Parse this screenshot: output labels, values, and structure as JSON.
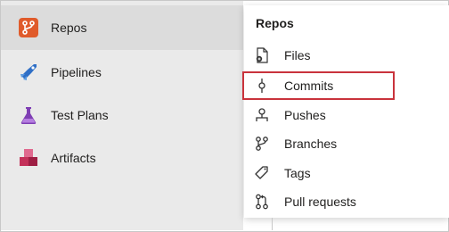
{
  "sidebar": {
    "items": [
      {
        "label": "Repos",
        "icon": "repos-icon",
        "active": true
      },
      {
        "label": "Pipelines",
        "icon": "pipelines-icon"
      },
      {
        "label": "Test Plans",
        "icon": "test-plans-icon"
      },
      {
        "label": "Artifacts",
        "icon": "artifacts-icon"
      }
    ]
  },
  "flyout": {
    "title": "Repos",
    "items": [
      {
        "label": "Files",
        "icon": "file-icon"
      },
      {
        "label": "Commits",
        "icon": "commit-icon",
        "highlighted": true
      },
      {
        "label": "Pushes",
        "icon": "push-icon"
      },
      {
        "label": "Branches",
        "icon": "branch-icon"
      },
      {
        "label": "Tags",
        "icon": "tag-icon"
      },
      {
        "label": "Pull requests",
        "icon": "pull-request-icon"
      }
    ]
  },
  "colors": {
    "repos": "#e05b2b",
    "pipelines": "#2f6fc6",
    "test_plans": "#7f3fb4",
    "artifacts": "#c4315a",
    "highlight_border": "#c9333c"
  }
}
